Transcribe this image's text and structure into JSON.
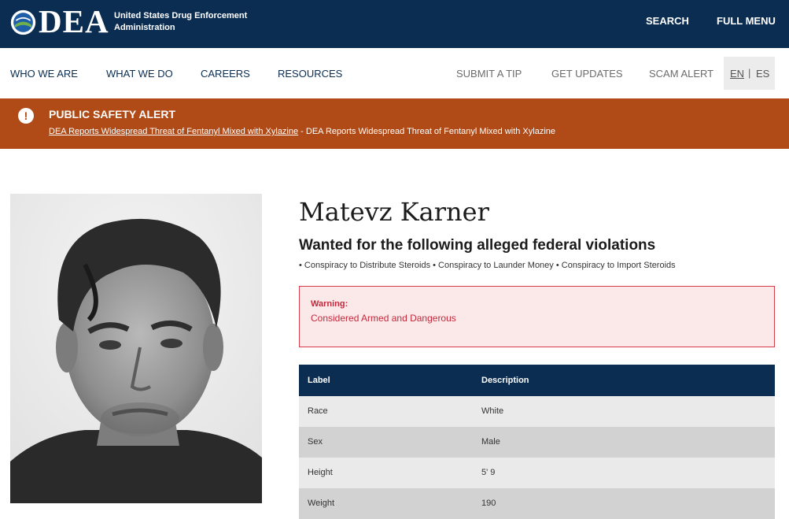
{
  "header": {
    "logo_text": "DEA",
    "agency_line1": "United States Drug Enforcement",
    "agency_line2": "Administration",
    "search_label": "SEARCH",
    "menu_label": "FULL MENU"
  },
  "nav": {
    "items": [
      "WHO WE ARE",
      "WHAT WE DO",
      "CAREERS",
      "RESOURCES"
    ],
    "utility": [
      "SUBMIT A TIP",
      "GET UPDATES",
      "SCAM ALERT"
    ],
    "lang_en": "EN",
    "lang_sep": "|",
    "lang_es": "ES"
  },
  "alert": {
    "icon": "exclamation-icon",
    "icon_glyph": "!",
    "title": "PUBLIC SAFETY ALERT",
    "link_text": "DEA Reports Widespread Threat of Fentanyl Mixed with Xylazine",
    "separator": " - ",
    "description": "DEA Reports Widespread Threat of Fentanyl Mixed with Xylazine"
  },
  "fugitive": {
    "name": "Matevz Karner",
    "subheading": "Wanted for the following alleged federal violations",
    "violations": "• Conspiracy to Distribute Steroids • Conspiracy to Launder Money • Conspiracy to Import Steroids",
    "warning_label": "Warning:",
    "warning_text": "Considered Armed and Dangerous"
  },
  "table": {
    "headers": [
      "Label",
      "Description"
    ],
    "rows": [
      [
        "Race",
        "White"
      ],
      [
        "Sex",
        "Male"
      ],
      [
        "Height",
        "5' 9"
      ],
      [
        "Weight",
        "190"
      ]
    ]
  },
  "colors": {
    "navy": "#0b2d52",
    "alert_orange": "#b04a16",
    "warning_red": "#c3283a",
    "warning_bg": "#fbe9ea"
  }
}
